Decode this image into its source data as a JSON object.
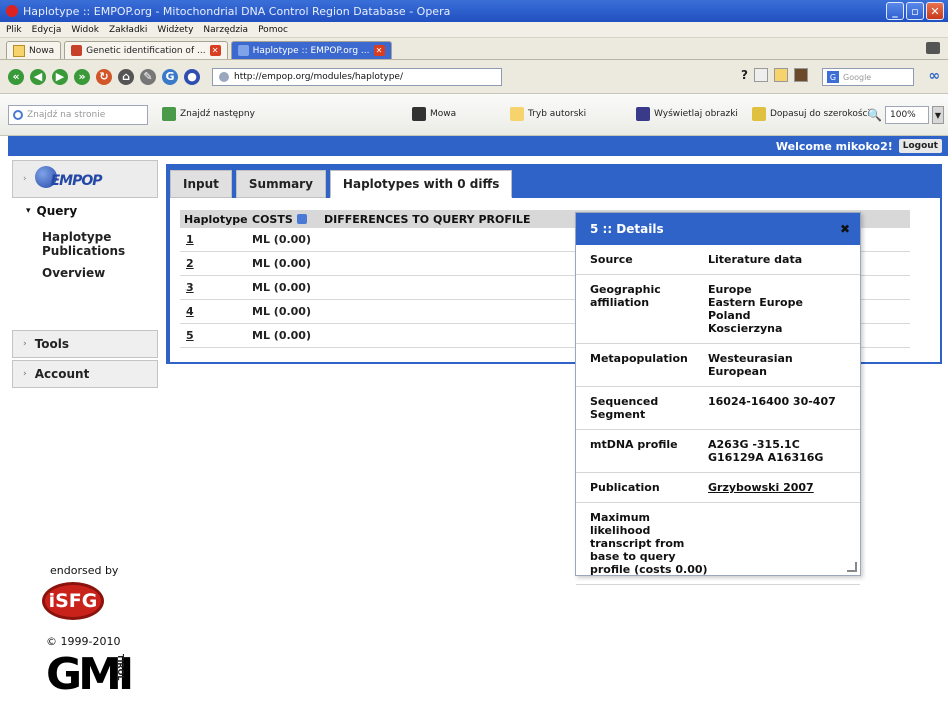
{
  "window": {
    "title": "Haplotype :: EMPOP.org - Mitochondrial DNA Control Region Database - Opera"
  },
  "menu": [
    "Plik",
    "Edycja",
    "Widok",
    "Zakładki",
    "Widżety",
    "Narzędzia",
    "Pomoc"
  ],
  "browser_tabs": {
    "new_tab": "Nowa",
    "tabs": [
      "Genetic identification of ...",
      "Haplotype :: EMPOP.org ..."
    ]
  },
  "address": {
    "url": "http://empop.org/modules/haplotype/",
    "search_placeholder": "Google"
  },
  "findbar": {
    "placeholder": "Znajdź na stronie",
    "find_next": "Znajdź następny",
    "speech": "Mowa",
    "author_mode": "Tryb autorski",
    "show_images": "Wyświetlaj obrazki",
    "fit_width": "Dopasuj do szerokości",
    "zoom": "100%"
  },
  "header": {
    "welcome": "Welcome mikoko2!",
    "logout": "Logout"
  },
  "sidebar": {
    "logo": "EMPOP",
    "query_label": "Query",
    "links": [
      "Haplotype",
      "Publications",
      "Overview"
    ],
    "tools": "Tools",
    "account": "Account",
    "endorsed": "endorsed by",
    "isfg": "iSFG",
    "copyright": "© 1999-2010",
    "gmi": "GMI",
    "gmi_vertical": "TIROL"
  },
  "content_tabs": [
    "Input",
    "Summary",
    "Haplotypes with 0 diffs"
  ],
  "results": {
    "headers": [
      "Haplotype",
      "COSTS",
      "DIFFERENCES TO QUERY PROFILE"
    ],
    "rows": [
      {
        "id": "1",
        "cost": "ML (0.00)"
      },
      {
        "id": "2",
        "cost": "ML (0.00)"
      },
      {
        "id": "3",
        "cost": "ML (0.00)"
      },
      {
        "id": "4",
        "cost": "ML (0.00)"
      },
      {
        "id": "5",
        "cost": "ML (0.00)"
      }
    ]
  },
  "details": {
    "title": "5 :: Details",
    "rows": [
      {
        "key": "Source",
        "value": "Literature data"
      },
      {
        "key": "Geographic affiliation",
        "value": "Europe\nEastern Europe\nPoland\nKoscierzyna"
      },
      {
        "key": "Metapopulation",
        "value": "Westeurasian\nEuropean"
      },
      {
        "key": "Sequenced Segment",
        "value": "16024-16400 30-407"
      },
      {
        "key": "mtDNA profile",
        "value": "A263G -315.1C\nG16129A A16316G"
      },
      {
        "key": "Publication",
        "value": "Grzybowski 2007"
      },
      {
        "key": "Maximum likelihood transcript from base to query profile (costs 0.00)",
        "value": ""
      }
    ]
  }
}
